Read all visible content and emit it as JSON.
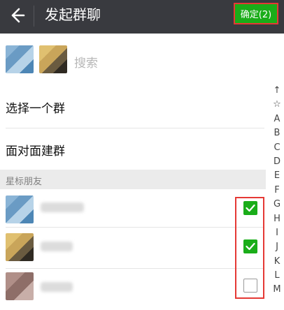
{
  "header": {
    "title": "发起群聊",
    "confirm_label": "确定(2)"
  },
  "search": {
    "placeholder_text": "搜索"
  },
  "menu": [
    {
      "label": "选择一个群"
    },
    {
      "label": "面对面建群"
    }
  ],
  "section": {
    "label": "星标朋友"
  },
  "contacts": [
    {
      "checked": true
    },
    {
      "checked": true
    },
    {
      "checked": false
    }
  ],
  "index": [
    "↑",
    "☆",
    "A",
    "B",
    "C",
    "D",
    "E",
    "F",
    "G",
    "H",
    "I",
    "J",
    "K",
    "L",
    "M"
  ],
  "colors": {
    "header_bg": "#393a3f",
    "accent_green": "#1aad19",
    "highlight_red": "#e53935"
  },
  "icons": {
    "back": "back-arrow-icon",
    "check": "checkmark-icon"
  }
}
